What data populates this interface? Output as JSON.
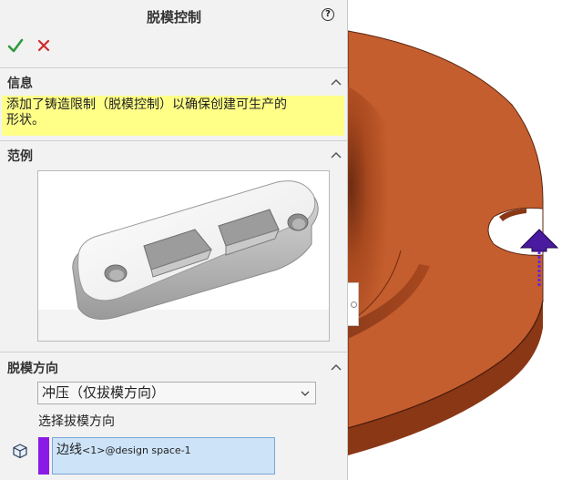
{
  "panel": {
    "title": "脱模控制",
    "help_icon": "question-circle-icon",
    "ok_icon": "check-icon",
    "cancel_icon": "close-icon"
  },
  "info": {
    "heading": "信息",
    "message_line1": "添加了铸造限制（脱模控制）以确保创建可生产的",
    "message_line2": "形状。"
  },
  "example": {
    "heading": "范例"
  },
  "direction": {
    "heading": "脱模方向",
    "selected_option": "冲压（仅拔模方向）",
    "select_label": "选择拔模方向",
    "selection_main": "边线",
    "selection_small": "<1>",
    "selection_rest": "@design space-1"
  },
  "colors": {
    "part_face": "#c45e2e",
    "part_side": "#9c4420",
    "highlight": "#ffff88",
    "selection_accent": "#8a1be6",
    "selection_bg": "#cde3f8",
    "ok_green": "#2e9a3a",
    "cancel_red": "#d12b2b"
  }
}
